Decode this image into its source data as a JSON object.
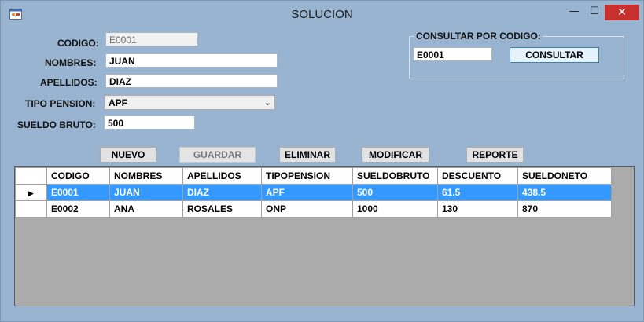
{
  "window": {
    "title": "SOLUCION",
    "min": "—",
    "max": "☐",
    "close": "✕"
  },
  "form": {
    "codigo_label": "CODIGO:",
    "codigo_value": "E0001",
    "nombres_label": "NOMBRES:",
    "nombres_value": "JUAN",
    "apellidos_label": "APELLIDOS:",
    "apellidos_value": "DIAZ",
    "tipo_pension_label": "TIPO PENSION:",
    "tipo_pension_value": "APF",
    "sueldo_label": "SUELDO BRUTO:",
    "sueldo_value": "500"
  },
  "consulta": {
    "group_title": "CONSULTAR POR CODIGO:",
    "codigo_value": "E0001",
    "button": "CONSULTAR"
  },
  "buttons": {
    "nuevo": "NUEVO",
    "guardar": "GUARDAR",
    "eliminar": "ELIMINAR",
    "modificar": "MODIFICAR",
    "reporte": "REPORTE"
  },
  "grid": {
    "columns": [
      "CODIGO",
      "NOMBRES",
      "APELLIDOS",
      "TIPOPENSION",
      "SUELDOBRUTO",
      "DESCUENTO",
      "SUELDONETO"
    ],
    "rows": [
      [
        "E0001",
        "JUAN",
        "DIAZ",
        "APF",
        "500",
        "61.5",
        "438.5"
      ],
      [
        "E0002",
        "ANA",
        "ROSALES",
        "ONP",
        "1000",
        "130",
        "870"
      ]
    ],
    "row_pointer": "▶"
  },
  "colors": {
    "window_bg": "#99b4d1",
    "selection": "#3399ff",
    "close_button": "#c7302c",
    "grid_bg": "#ababab"
  },
  "icons": {
    "app": "app-icon",
    "dropdown": "chevron-down-icon",
    "row_pointer": "row-pointer-icon"
  }
}
